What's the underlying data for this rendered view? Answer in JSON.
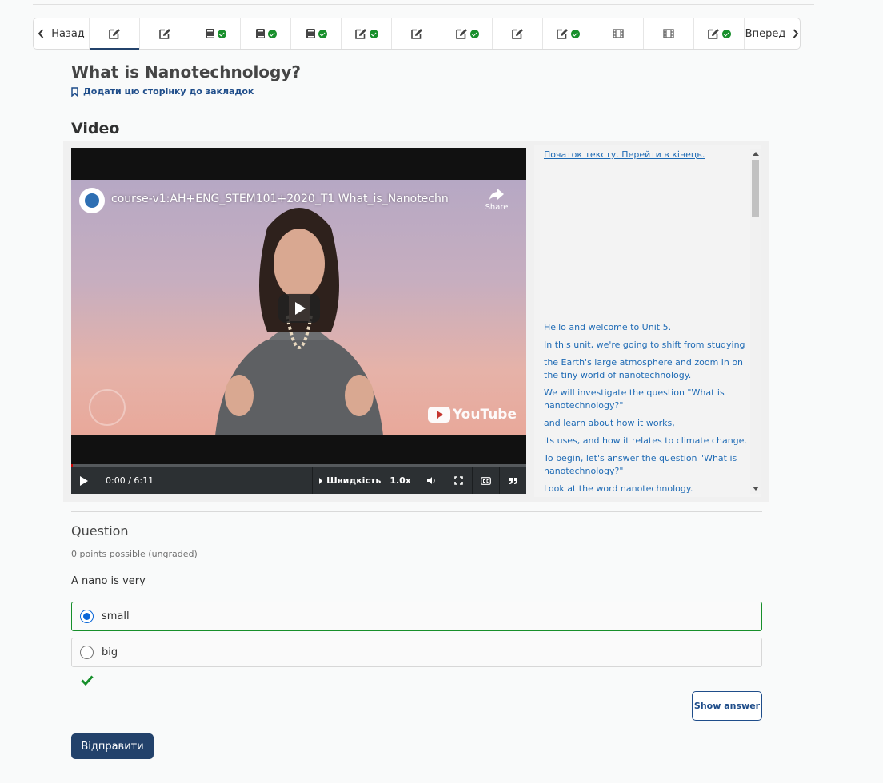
{
  "nav": {
    "prev_label": "Назад",
    "next_label": "Вперед",
    "tabs": [
      {
        "icon": "edit-icon",
        "done": false,
        "active": true
      },
      {
        "icon": "edit-icon",
        "done": false,
        "active": false
      },
      {
        "icon": "book-icon",
        "done": true,
        "active": false
      },
      {
        "icon": "book-icon",
        "done": true,
        "active": false
      },
      {
        "icon": "book-icon",
        "done": true,
        "active": false
      },
      {
        "icon": "edit-icon",
        "done": true,
        "active": false
      },
      {
        "icon": "edit-icon",
        "done": false,
        "active": false
      },
      {
        "icon": "edit-icon",
        "done": true,
        "active": false
      },
      {
        "icon": "edit-icon",
        "done": false,
        "active": false
      },
      {
        "icon": "edit-icon",
        "done": true,
        "active": false
      },
      {
        "icon": "film-icon",
        "done": false,
        "active": false
      },
      {
        "icon": "film-icon",
        "done": false,
        "active": false
      },
      {
        "icon": "edit-icon",
        "done": true,
        "active": false
      }
    ]
  },
  "page": {
    "title": "What is Nanotechnology?",
    "bookmark_label": "Додати цю сторінку до закладок",
    "video_heading": "Video"
  },
  "video": {
    "title": "course-v1:AH+ENG_STEM101+2020_T1 What_is_Nanotechn",
    "share_label": "Share",
    "brand": "YouTube",
    "time": "0:00 / 6:11",
    "speed_label": "Швидкість",
    "speed_value": "1.0x"
  },
  "transcript": {
    "top_link": "Початок тексту. Перейти в кінець.",
    "lines": [
      "Hello and welcome to Unit 5.",
      "In this unit, we're going to shift from studying",
      "the Earth's large atmosphere and zoom in on the tiny world of nanotechnology.",
      "We will investigate the question \"What is nanotechnology?\"",
      "and learn about how it works,",
      "its uses, and how it relates to climate change.",
      "To begin, let's answer the question \"What is nanotechnology?\"",
      "Look at the word nanotechnology."
    ]
  },
  "question": {
    "heading": "Question",
    "points": "0 points possible (ungraded)",
    "text": "A nano is very",
    "choices": [
      {
        "label": "small",
        "selected": true
      },
      {
        "label": "big",
        "selected": false
      }
    ],
    "show_answer": "Show answer",
    "submit": "Відправити"
  },
  "colors": {
    "accent": "#23426b",
    "link": "#1f6bb5",
    "correct": "#178f2b"
  }
}
